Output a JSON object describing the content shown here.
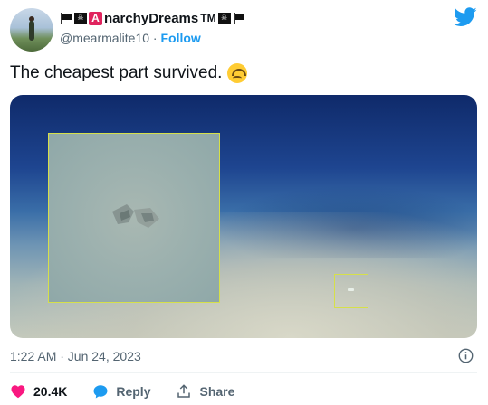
{
  "author": {
    "display_name": "narchyDreams",
    "name_prefix_letter": "A",
    "tm": "TM",
    "handle": "@mearmalite10",
    "separator": "·",
    "follow_label": "Follow"
  },
  "tweet": {
    "text": "The cheapest part survived.",
    "emoji": "upside-down-face-emoji"
  },
  "media": {
    "description_icon": "image-underwater-debris"
  },
  "meta": {
    "timestamp": "1:22 AM · Jun 24, 2023"
  },
  "actions": {
    "like_count": "20.4K",
    "reply_label": "Reply",
    "share_label": "Share"
  },
  "colors": {
    "accent": "#1d9bf0",
    "like": "#f91880",
    "highlight_box": "#d6e04a"
  }
}
